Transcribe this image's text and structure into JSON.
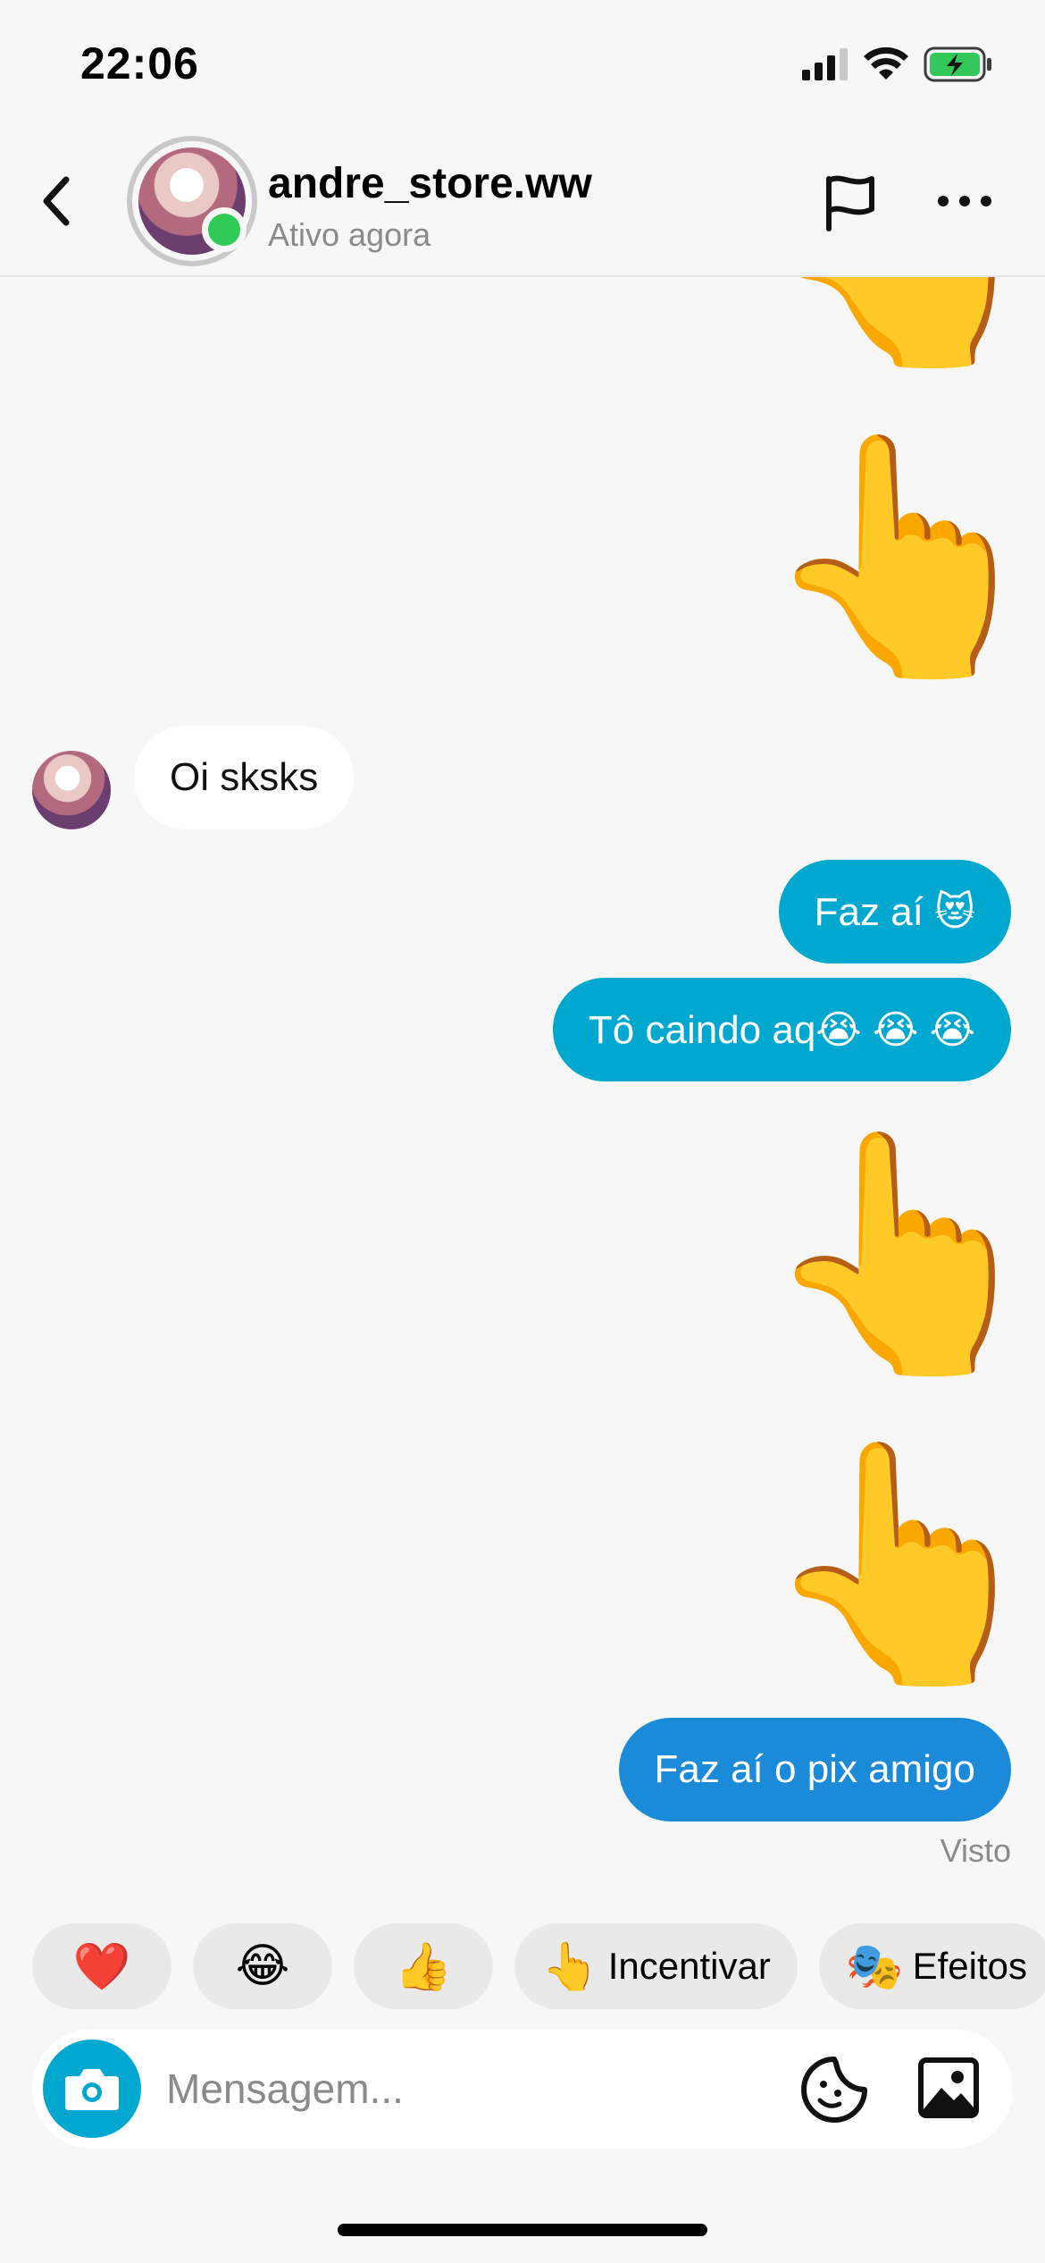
{
  "status_bar": {
    "time": "22:06"
  },
  "header": {
    "username": "andre_store.ww",
    "status": "Ativo agora"
  },
  "messages": {
    "incoming_1": "Oi sksks",
    "out_1": "Faz aí 😻",
    "out_2": "Tô caindo aq😭 😭 😭",
    "out_3": "Faz aí o pix amigo",
    "hand_emoji": "👆",
    "seen": "Visto"
  },
  "quick_replies": [
    {
      "emoji": "❤️",
      "label": ""
    },
    {
      "emoji": "😂",
      "label": ""
    },
    {
      "emoji": "👍",
      "label": ""
    },
    {
      "emoji": "👆",
      "label": "Incentivar"
    },
    {
      "emoji": "🎭",
      "label": "Efeitos"
    }
  ],
  "composer": {
    "placeholder": "Mensagem..."
  },
  "colors": {
    "outgoing_bubble": "#00a7cf",
    "outgoing_bubble_alt": "#1a8ad9",
    "online": "#2ecc55",
    "accent": "#00a7cf"
  },
  "icons": [
    "back-icon",
    "flag-icon",
    "more-icon",
    "camera-icon",
    "sticker-icon",
    "gallery-icon",
    "signal-icon",
    "wifi-icon",
    "battery-icon"
  ]
}
